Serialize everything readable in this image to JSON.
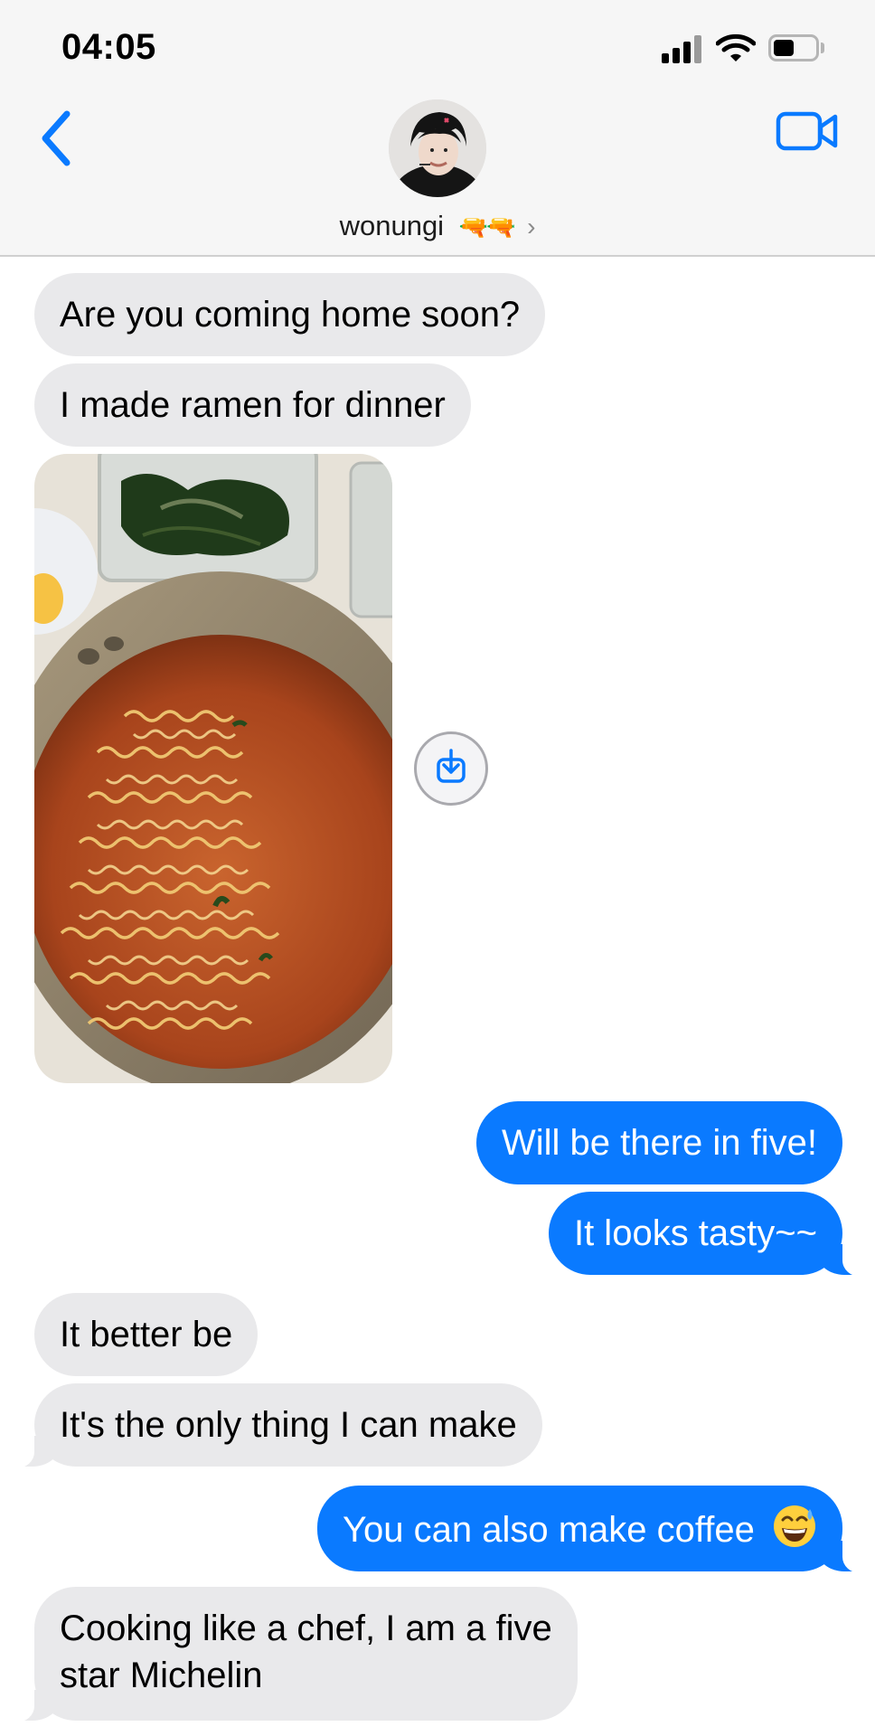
{
  "status_bar": {
    "time": "04:05"
  },
  "header": {
    "contact_name": "wonungi",
    "name_emoji": "🔫🔫",
    "chevron": "›",
    "back_icon": "chevron-left-icon",
    "call_icon": "video-camera-icon",
    "accent_color": "#0a7aff"
  },
  "messages": [
    {
      "side": "received",
      "text": "Are you coming home soon?"
    },
    {
      "side": "received",
      "text": "I made ramen for dinner"
    },
    {
      "side": "received",
      "type": "image",
      "content": "photo"
    },
    {
      "side": "sent",
      "text": "Will be there in five!"
    },
    {
      "side": "sent",
      "text": "It looks tasty~~"
    },
    {
      "side": "received",
      "text": "It better be"
    },
    {
      "side": "received",
      "text": "It's the only thing I can make"
    },
    {
      "side": "sent",
      "text": "You can also make coffee"
    },
    {
      "side": "received",
      "text_line1": "Cooking like a chef, I am a five",
      "text_line2": "star Michelin"
    }
  ],
  "colors": {
    "sent_bubble": "#0a7aff",
    "received_bubble": "#e9e9eb"
  }
}
